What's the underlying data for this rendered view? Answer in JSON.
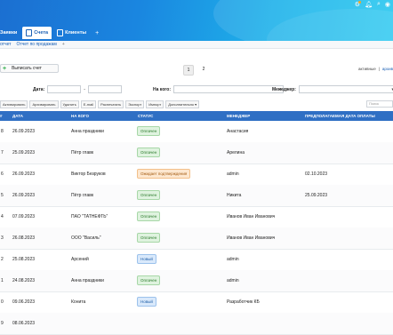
{
  "header": {
    "tabs": [
      {
        "label": "Заявки",
        "active": false
      },
      {
        "label": "Счета",
        "active": true
      },
      {
        "label": "Клиенты",
        "active": false
      }
    ],
    "add_tab": "+",
    "icons": [
      "gear-icon",
      "bell-icon",
      "search-icon",
      "avatar"
    ]
  },
  "subnav": {
    "items": [
      "отчет",
      "Отчет по продажам"
    ],
    "add": "+"
  },
  "toolbar": {
    "create_label": "Выписать счет",
    "pages": [
      "1",
      "2"
    ],
    "view_active": "активные",
    "view_sep": "|",
    "view_archive": "архив"
  },
  "filters": {
    "date_label": "Дата:",
    "date_dash": "-",
    "from_label": "На кого:",
    "manager_label": "Менеджер:"
  },
  "actions": [
    "Активировать",
    "Архивировать",
    "Удалить",
    "E-mail",
    "Распечатать",
    "Экспорт",
    "Импорт",
    "Дополнительно ▾"
  ],
  "search_placeholder": "Поиск",
  "table": {
    "headers": [
      "#",
      "ДАТА",
      "НА КОГО",
      "СТАТУС",
      "МЕНЕДЖЕР",
      "ПРЕДПОЛАГАЕМАЯ ДАТА ОПЛАТЫ"
    ],
    "rows": [
      {
        "id": "8",
        "date": "26.09.2023",
        "to": "Анна праздники",
        "status": "Оплачен",
        "kind": "paid",
        "manager": "Анастасия",
        "due": ""
      },
      {
        "id": "7",
        "date": "25.09.2023",
        "to": "Пётр главк",
        "status": "Оплачен",
        "kind": "paid",
        "manager": "Арелина",
        "due": ""
      },
      {
        "id": "6",
        "date": "26.09.2023",
        "to": "Виктор Безруков",
        "status": "Ожидает подтверждения",
        "kind": "wait",
        "manager": "admin",
        "due": "02.10.2023"
      },
      {
        "id": "5",
        "date": "26.09.2023",
        "to": "Пётр главк",
        "status": "Оплачен",
        "kind": "paid",
        "manager": "Никита",
        "due": "25.09.2023"
      },
      {
        "id": "4",
        "date": "07.09.2023",
        "to": "ПАО \"ТАТНЕФТЬ\"",
        "status": "Оплачен",
        "kind": "paid",
        "manager": "Иванов Иван Иванович",
        "due": ""
      },
      {
        "id": "3",
        "date": "26.08.2023",
        "to": "ООО \"Василь\"",
        "status": "Оплачен",
        "kind": "paid",
        "manager": "Иванов Иван Иванович",
        "due": ""
      },
      {
        "id": "2",
        "date": "25.08.2023",
        "to": "Арсений",
        "status": "Новый",
        "kind": "new",
        "manager": "admin",
        "due": ""
      },
      {
        "id": "1",
        "date": "24.08.2023",
        "to": "Анна праздники",
        "status": "Оплачен",
        "kind": "paid",
        "manager": "admin",
        "due": ""
      },
      {
        "id": "0",
        "date": "09.06.2023",
        "to": "Конита",
        "status": "Новый",
        "kind": "new",
        "manager": "Разработчик КБ",
        "due": ""
      },
      {
        "id": "9",
        "date": "08.06.2023",
        "to": "",
        "status": "",
        "kind": "paid",
        "manager": "",
        "due": ""
      }
    ]
  }
}
